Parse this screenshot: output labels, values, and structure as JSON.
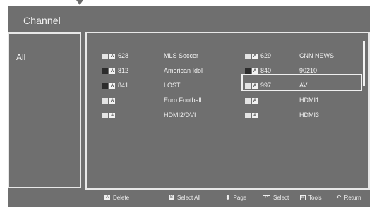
{
  "panel": {
    "title": "Channel"
  },
  "left": {
    "label": "All"
  },
  "channels": {
    "columns": [
      [
        {
          "icon": "box-light",
          "num": "628",
          "name": "MLS Soccer"
        },
        {
          "icon": "box-dark",
          "num": "812",
          "name": "American Idol"
        },
        {
          "icon": "box-dark",
          "num": "841",
          "name": "LOST"
        },
        {
          "icon": "box-light",
          "num": "",
          "name": "Euro Football"
        },
        {
          "icon": "box-light",
          "num": "",
          "name": "HDMI2/DVI"
        }
      ],
      [
        {
          "icon": "box-light",
          "num": "629",
          "name": "CNN NEWS"
        },
        {
          "icon": "box-dark",
          "num": "840",
          "name": "90210"
        },
        {
          "icon": "box-light",
          "num": "997",
          "name": "AV",
          "selected": true
        },
        {
          "icon": "box-light",
          "num": "",
          "name": "HDMI1"
        },
        {
          "icon": "box-light",
          "num": "",
          "name": "HDMI3"
        }
      ]
    ]
  },
  "footer": {
    "items": [
      {
        "icon": "a-icon",
        "label": "Delete"
      },
      {
        "icon": "b-icon",
        "label": "Select All"
      },
      {
        "icon": "page-icon",
        "label": "Page"
      },
      {
        "icon": "enter-icon",
        "label": "Select"
      },
      {
        "icon": "tools-icon",
        "label": "Tools"
      },
      {
        "icon": "return-icon",
        "label": "Return"
      }
    ]
  }
}
